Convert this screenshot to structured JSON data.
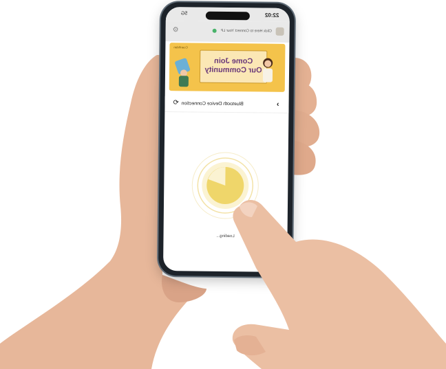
{
  "status_bar": {
    "time": "22:02",
    "signal": "5G"
  },
  "top_bar": {
    "connect_prompt": "Click Here to Connect Your LP"
  },
  "banner": {
    "tag": "Coanfidan",
    "line1": "Come Join",
    "line2": "Our Community"
  },
  "nav": {
    "title": "Bluetooth Device Connection"
  },
  "loader": {
    "status_text": "Loading..."
  },
  "colors": {
    "banner_bg": "#f4c34b",
    "loader_accent": "#e8c53c",
    "connect_dot": "#49b36a",
    "phone_frame": "#1d232a"
  },
  "icons": [
    "back-chevron-icon",
    "refresh-icon",
    "gear-icon",
    "avatar-icon",
    "status-dot-icon"
  ]
}
